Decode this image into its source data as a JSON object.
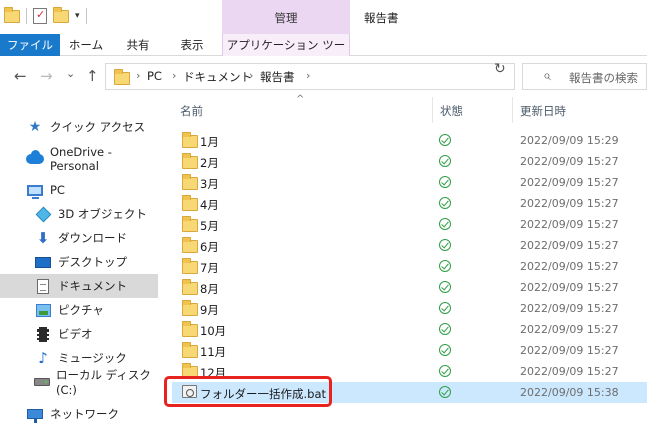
{
  "titlebar": {
    "manage_tab": "管理",
    "window_title": "報告書",
    "qat_dropdown": "▾"
  },
  "ribbon": {
    "tabs": [
      "ファイル",
      "ホーム",
      "共有",
      "表示",
      "アプリケーション ツール"
    ]
  },
  "nav_buttons": {
    "back": "←",
    "forward": "→",
    "dropdown": "⌄",
    "up": "↑",
    "refresh": "↻"
  },
  "address": {
    "crumbs": [
      "PC",
      "ドキュメント",
      "報告書"
    ],
    "separator": "›",
    "dropdown": "⌄"
  },
  "search": {
    "placeholder": "報告書の検索",
    "icon": "⌕"
  },
  "navpane": {
    "items": [
      {
        "label": "クイック アクセス",
        "icon": "star-icon",
        "glyph": "★"
      },
      {
        "label": "OneDrive - Personal",
        "icon": "cloud-icon"
      },
      {
        "label": "PC",
        "icon": "pc-icon"
      },
      {
        "label": "3D オブジェクト",
        "icon": "cube-icon"
      },
      {
        "label": "ダウンロード",
        "icon": "download-icon",
        "glyph": "⬇"
      },
      {
        "label": "デスクトップ",
        "icon": "desktop-icon"
      },
      {
        "label": "ドキュメント",
        "icon": "document-icon",
        "selected": true
      },
      {
        "label": "ピクチャ",
        "icon": "picture-icon"
      },
      {
        "label": "ビデオ",
        "icon": "video-icon"
      },
      {
        "label": "ミュージック",
        "icon": "music-icon",
        "glyph": "♪"
      },
      {
        "label": "ローカル ディスク (C:)",
        "icon": "drive-icon"
      },
      {
        "label": "ネットワーク",
        "icon": "network-icon"
      }
    ]
  },
  "columns": {
    "name": "名前",
    "status": "状態",
    "modified": "更新日時",
    "sort_indicator": "^"
  },
  "files": [
    {
      "name": "1月",
      "date": "2022/09/09 15:29",
      "type": "folder"
    },
    {
      "name": "2月",
      "date": "2022/09/09 15:27",
      "type": "folder"
    },
    {
      "name": "3月",
      "date": "2022/09/09 15:27",
      "type": "folder"
    },
    {
      "name": "4月",
      "date": "2022/09/09 15:27",
      "type": "folder"
    },
    {
      "name": "5月",
      "date": "2022/09/09 15:27",
      "type": "folder"
    },
    {
      "name": "6月",
      "date": "2022/09/09 15:27",
      "type": "folder"
    },
    {
      "name": "7月",
      "date": "2022/09/09 15:27",
      "type": "folder"
    },
    {
      "name": "8月",
      "date": "2022/09/09 15:27",
      "type": "folder"
    },
    {
      "name": "9月",
      "date": "2022/09/09 15:27",
      "type": "folder"
    },
    {
      "name": "10月",
      "date": "2022/09/09 15:27",
      "type": "folder"
    },
    {
      "name": "11月",
      "date": "2022/09/09 15:27",
      "type": "folder"
    },
    {
      "name": "12月",
      "date": "2022/09/09 15:27",
      "type": "folder"
    },
    {
      "name": "フォルダー一括作成.bat",
      "date": "2022/09/09 15:38",
      "type": "batch",
      "selected": true
    }
  ],
  "colors": {
    "file_tab": "#1979ca",
    "manage_tab": "#ecd7f2",
    "selection": "#cce8ff",
    "highlight_box": "#e8231f",
    "sync_ok": "#2f9e44"
  }
}
